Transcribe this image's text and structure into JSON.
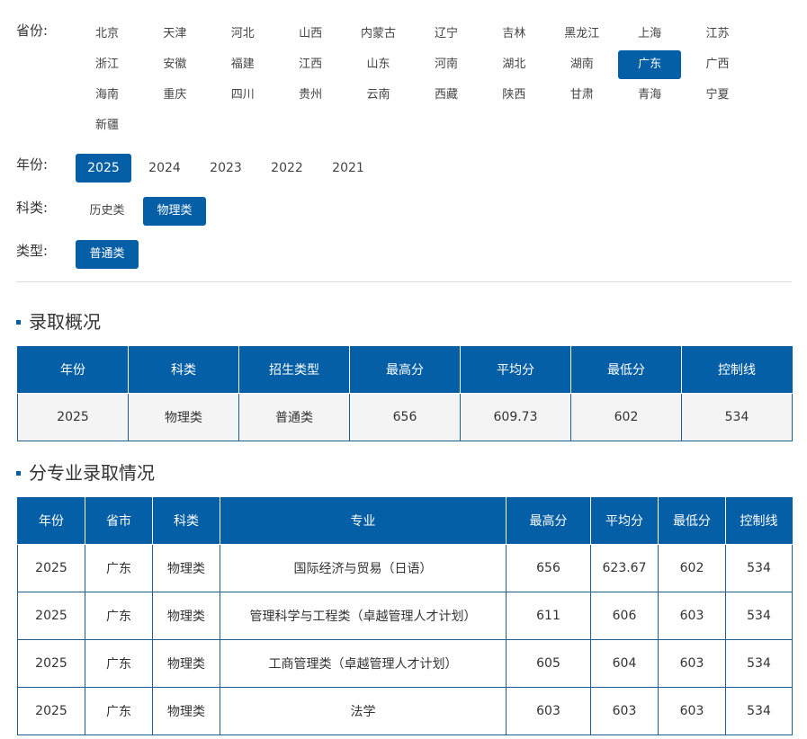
{
  "filters": {
    "province": {
      "label": "省份:",
      "options": [
        "北京",
        "天津",
        "河北",
        "山西",
        "内蒙古",
        "辽宁",
        "吉林",
        "黑龙江",
        "上海",
        "江苏",
        "浙江",
        "安徽",
        "福建",
        "江西",
        "山东",
        "河南",
        "湖北",
        "湖南",
        "广东",
        "广西",
        "海南",
        "重庆",
        "四川",
        "贵州",
        "云南",
        "西藏",
        "陕西",
        "甘肃",
        "青海",
        "宁夏",
        "新疆"
      ],
      "selected": "广东"
    },
    "year": {
      "label": "年份:",
      "options": [
        "2025",
        "2024",
        "2023",
        "2022",
        "2021"
      ],
      "selected": "2025"
    },
    "subject": {
      "label": "科类:",
      "options": [
        "历史类",
        "物理类"
      ],
      "selected": "物理类"
    },
    "type": {
      "label": "类型:",
      "options": [
        "普通类"
      ],
      "selected": "普通类"
    }
  },
  "overview": {
    "title": "录取概况",
    "headers": [
      "年份",
      "科类",
      "招生类型",
      "最高分",
      "平均分",
      "最低分",
      "控制线"
    ],
    "rows": [
      [
        "2025",
        "物理类",
        "普通类",
        "656",
        "609.73",
        "602",
        "534"
      ]
    ]
  },
  "majors": {
    "title": "分专业录取情况",
    "headers": [
      "年份",
      "省市",
      "科类",
      "专业",
      "最高分",
      "平均分",
      "最低分",
      "控制线"
    ],
    "rows": [
      [
        "2025",
        "广东",
        "物理类",
        "国际经济与贸易（日语）",
        "656",
        "623.67",
        "602",
        "534"
      ],
      [
        "2025",
        "广东",
        "物理类",
        "管理科学与工程类（卓越管理人才计划）",
        "611",
        "606",
        "603",
        "534"
      ],
      [
        "2025",
        "广东",
        "物理类",
        "工商管理类（卓越管理人才计划）",
        "605",
        "604",
        "603",
        "534"
      ],
      [
        "2025",
        "广东",
        "物理类",
        "法学",
        "603",
        "603",
        "603",
        "534"
      ]
    ]
  },
  "colors": {
    "accent": "#045fa6",
    "border": "#1c5f8f"
  }
}
